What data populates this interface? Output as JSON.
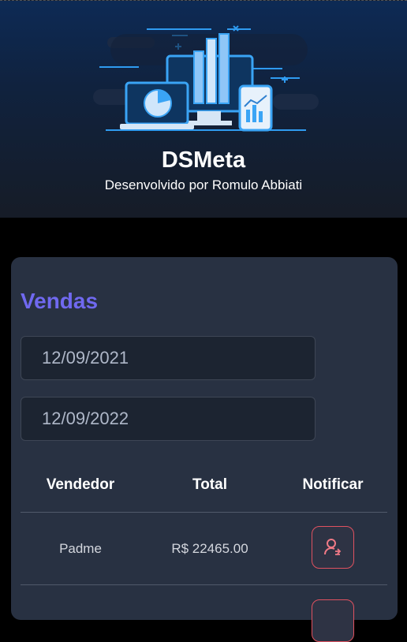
{
  "header": {
    "title": "DSMeta",
    "subtitle": "Desenvolvido por Romulo Abbiati",
    "logo_icon": "analytics-devices-illustration-icon"
  },
  "sales": {
    "title": "Vendas",
    "min_date": "12/09/2021",
    "max_date": "12/09/2022",
    "columns": [
      "Vendedor",
      "Total",
      "Notificar"
    ],
    "rows": [
      {
        "seller": "Padme",
        "total": "R$ 22465.00",
        "notify_icon": "user-notify-icon"
      }
    ]
  },
  "colors": {
    "accent": "#7069f0",
    "card_bg": "#283142",
    "notify_border": "#e05260",
    "page_bg": "#000000"
  }
}
